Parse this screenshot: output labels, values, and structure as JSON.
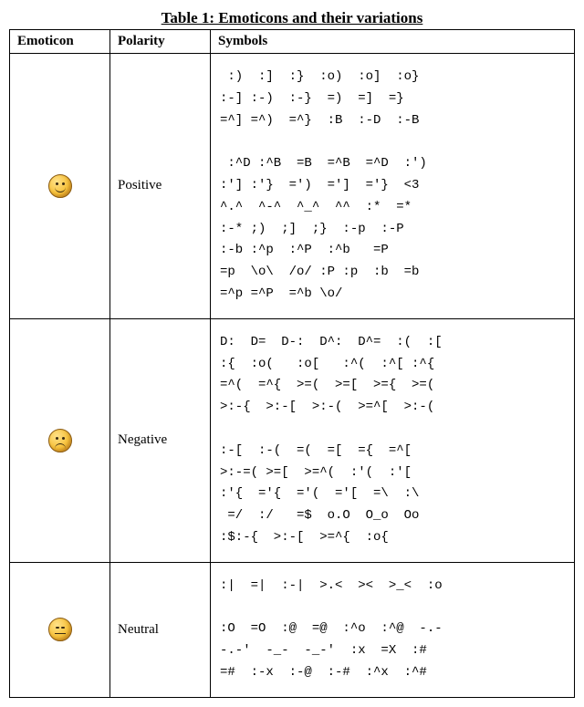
{
  "caption": "Table 1: Emoticons and their variations",
  "headers": {
    "emoticon": "Emoticon",
    "polarity": "Polarity",
    "symbols": "Symbols"
  },
  "rows": [
    {
      "icon_name": "happy-face-icon",
      "polarity": "Positive",
      "symbols": " :)  :]  :}  :o)  :o]  :o}\n:-] :-)  :-}  =)  =]  =}\n=^] =^)  =^}  :B  :-D  :-B\n\n :^D :^B  =B  =^B  =^D  :')\n:'] :'}  =')  =']  ='}  <3\n^.^  ^-^  ^_^  ^^  :*  =*\n:-* ;)  ;]  ;}  :-p  :-P\n:-b :^p  :^P  :^b   =P\n=p  \\o\\  /o/ :P :p  :b  =b\n=^p =^P  =^b \\o/"
    },
    {
      "icon_name": "sad-face-icon",
      "polarity": "Negative",
      "symbols": "D:  D=  D-:  D^:  D^=  :(  :[\n:{  :o(   :o[   :^(  :^[ :^{\n=^(  =^{  >=(  >=[  >={  >=(\n>:-{  >:-[  >:-(  >=^[  >:-(\n\n:-[  :-(  =(  =[  ={  =^[\n>:-=( >=[  >=^(  :'(  :'[\n:'{  ='{  ='(  ='[  =\\  :\\\n =/  :/   =$  o.O  O_o  Oo\n:$:-{  >:-[  >=^{  :o{"
    },
    {
      "icon_name": "neutral-face-icon",
      "polarity": "Neutral",
      "symbols": ":|  =|  :-|  >.<  ><  >_<  :o\n\n:O  =O  :@  =@  :^o  :^@  -.-\n-.-'  -_-  -_-'  :x  =X  :#\n=#  :-x  :-@  :-#  :^x  :^#"
    }
  ]
}
